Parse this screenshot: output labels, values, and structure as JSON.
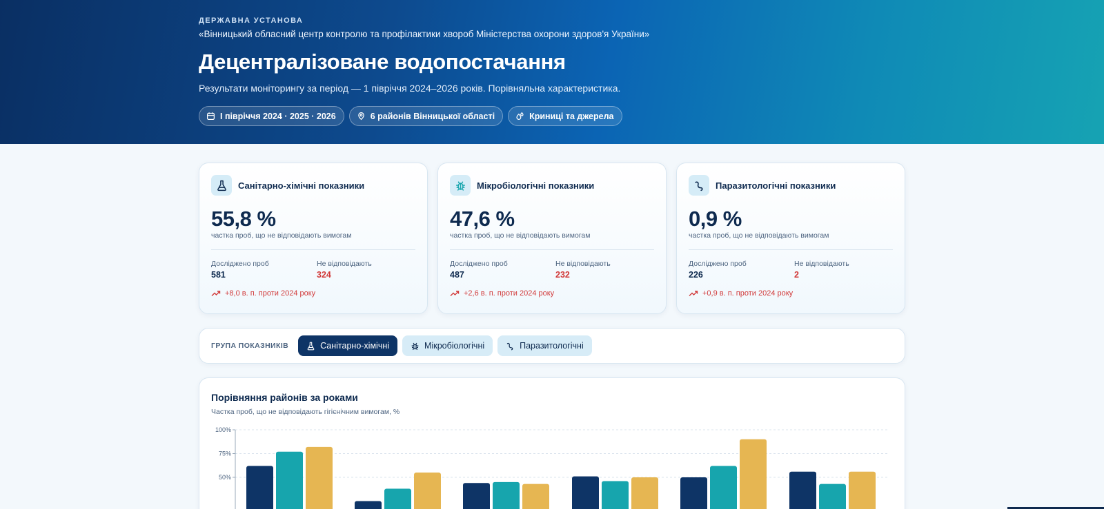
{
  "header": {
    "eyebrow": "ДЕРЖАВНА УСТАНОВА",
    "org": "«Вінницький обласний центр контролю та профілактики хвороб Міністерства охорони здоров'я України»",
    "title": "Децентралізоване водопостачання",
    "subtitle": "Результати моніторингу за період — 1 півріччя 2024–2026 років. Порівняльна характеристика.",
    "chips": [
      {
        "label": "I півріччя 2024 · 2025 · 2026",
        "icon": "calendar-icon"
      },
      {
        "label": "6 районів Вінницької області",
        "icon": "location-pin-icon"
      },
      {
        "label": "Криниці та джерела",
        "icon": "water-drops-icon"
      }
    ]
  },
  "cards": [
    {
      "title": "Санітарно-хімічні показники",
      "icon": "flask-icon",
      "value": "55,8 %",
      "caption": "частка проб, що не відповідають вимогам",
      "tested_label": "Досліджено проб",
      "tested": "581",
      "failed_label": "Не відповідають",
      "failed": "324",
      "trend": "+8,0 в. п. проти 2024 року"
    },
    {
      "title": "Мікробіологічні показники",
      "icon": "bug-icon",
      "value": "47,6 %",
      "caption": "частка проб, що не відповідають вимогам",
      "tested_label": "Досліджено проб",
      "tested": "487",
      "failed_label": "Не відповідають",
      "failed": "232",
      "trend": "+2,6 в. п. проти 2024 року"
    },
    {
      "title": "Паразитологічні показники",
      "icon": "worm-icon",
      "value": "0,9 %",
      "caption": "частка проб, що не відповідають вимогам",
      "tested_label": "Досліджено проб",
      "tested": "226",
      "failed_label": "Не відповідають",
      "failed": "2",
      "trend": "+0,9 в. п. проти 2024 року"
    }
  ],
  "filter": {
    "label": "ГРУПА ПОКАЗНИКІВ",
    "options": [
      {
        "label": "Санітарно-хімічні",
        "icon": "flask-icon",
        "active": true
      },
      {
        "label": "Мікробіологічні",
        "icon": "bug-icon",
        "active": false
      },
      {
        "label": "Паразитологічні",
        "icon": "worm-icon",
        "active": false
      }
    ]
  },
  "colors": {
    "series_2024": "#0e3466",
    "series_2025": "#17a5ad",
    "series_2026": "#e6b652",
    "danger": "#d13a3a"
  },
  "chart": {
    "title": "Порівняння районів за роками",
    "subtitle": "Частка проб, що не відповідають гігієнічним вимогам, %"
  },
  "chart_data": {
    "type": "bar",
    "title": "Порівняння районів за роками",
    "subtitle": "Частка проб, що не відповідають гігієнічним вимогам, %",
    "ylim": [
      0,
      100
    ],
    "yticks": [
      "100%",
      "75%",
      "50%"
    ],
    "ytick_values": [
      100,
      75,
      50
    ],
    "grid": true,
    "groups": 6,
    "series": [
      {
        "values": [
          62,
          25,
          44,
          51,
          50,
          56
        ]
      },
      {
        "values": [
          77,
          38,
          45,
          46,
          62,
          43
        ]
      },
      {
        "values": [
          82,
          55,
          43,
          50,
          90,
          56
        ]
      }
    ]
  }
}
